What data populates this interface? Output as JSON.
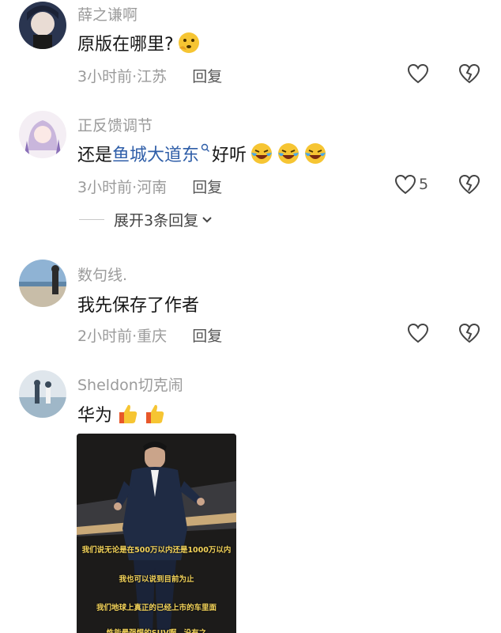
{
  "comments": [
    {
      "username": "薛之谦啊",
      "text": "原版在哪里?",
      "time": "3小时前",
      "location": "江苏",
      "reply": "回复"
    },
    {
      "username": "正反馈调节",
      "text_prefix": "还是",
      "link": "鱼城大道东",
      "text_suffix": "好听",
      "time": "3小时前",
      "location": "河南",
      "reply": "回复",
      "like_count": "5",
      "expand": "展开3条回复"
    },
    {
      "username": "数句线.",
      "text": "我先保存了作者",
      "time": "2小时前",
      "location": "重庆",
      "reply": "回复"
    },
    {
      "username": "Sheldon切克闹",
      "text": "华为",
      "video_subtitles": [
        "我们说无论是在500万以内还是1000万以内",
        "我也可以说到目前为止",
        "我们地球上真正的已经上市的车里面",
        "性能最强悍的SUV啊，没有之"
      ]
    }
  ],
  "meta_separator": "·",
  "icons": [
    "heart-outline-icon",
    "heart-broken-icon",
    "thinking-emoji-icon",
    "laughing-crying-emoji-icon",
    "thumbs-up-emoji-icon",
    "search-icon",
    "chevron-down-icon"
  ],
  "colors": {
    "link": "#2f5ea8",
    "meta": "#9b9b9b",
    "text": "#161616"
  }
}
